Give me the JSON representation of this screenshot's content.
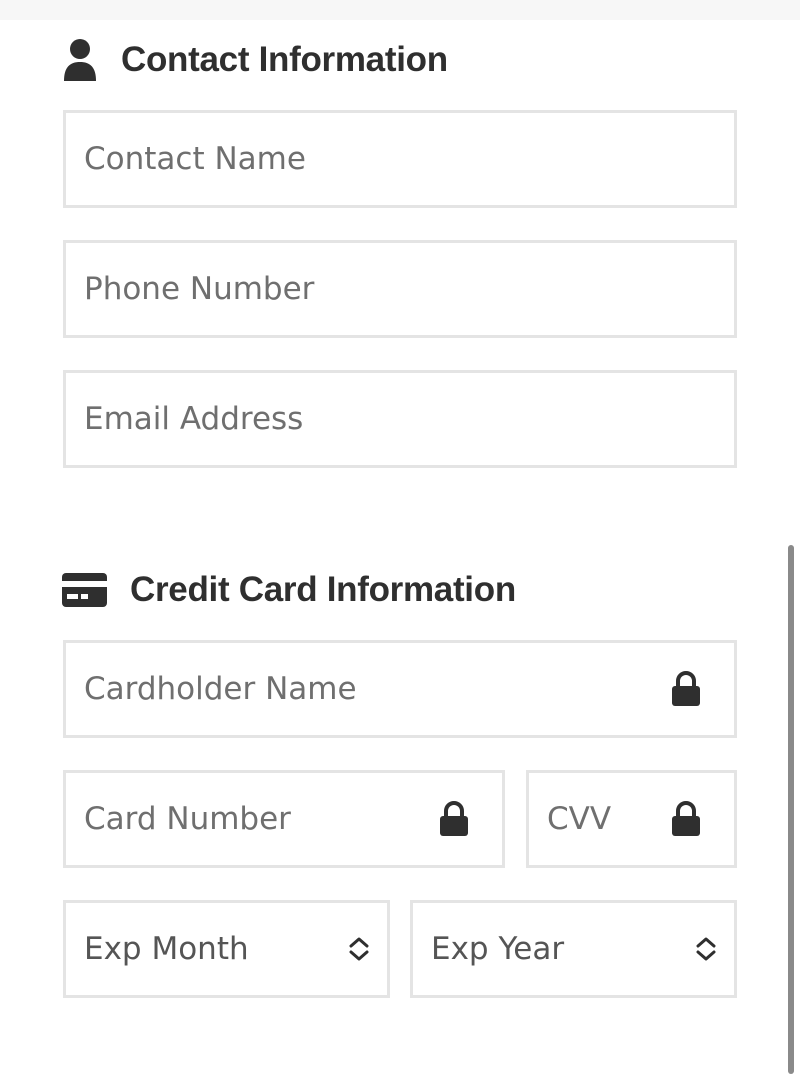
{
  "contact_section": {
    "title": "Contact Information",
    "icon": "user-icon"
  },
  "contact_fields": {
    "name_placeholder": "Contact Name",
    "phone_placeholder": "Phone Number",
    "email_placeholder": "Email Address"
  },
  "card_section": {
    "title": "Credit Card Information",
    "icon": "credit-card-icon"
  },
  "card_fields": {
    "holder_placeholder": "Cardholder Name",
    "number_placeholder": "Card Number",
    "cvv_placeholder": "CVV",
    "exp_month_label": "Exp Month",
    "exp_year_label": "Exp Year",
    "lock_icon": "lock-icon",
    "select_icon": "chevron-up-down-icon"
  },
  "colors": {
    "title_text": "#2f2f2f",
    "placeholder_text": "#6f6f6f",
    "field_border": "#e4e4e4",
    "icon": "#2f2f2f"
  }
}
